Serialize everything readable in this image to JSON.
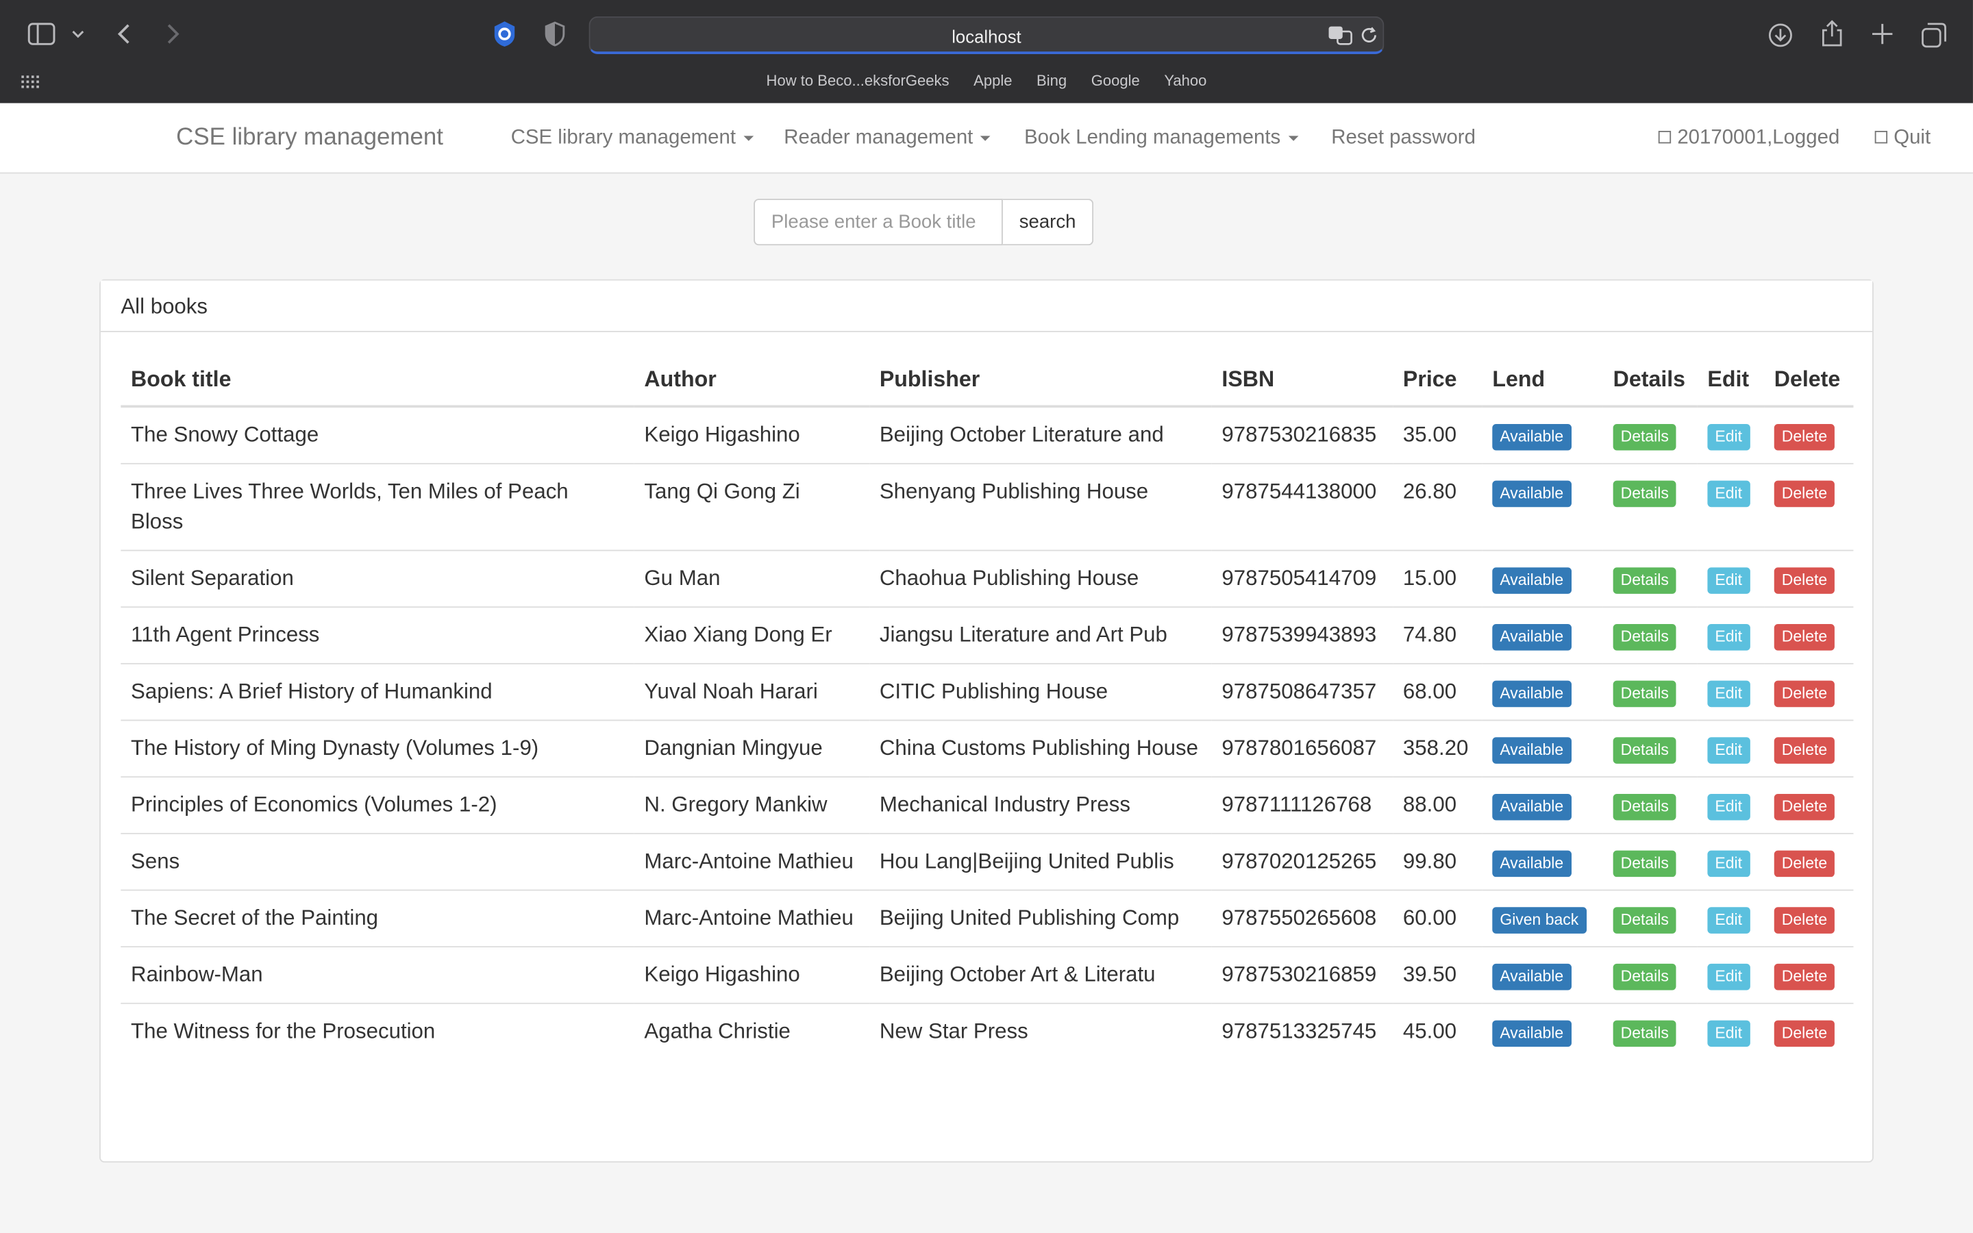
{
  "browser": {
    "url": "localhost",
    "favorites": [
      "How to Beco...eksforGeeks",
      "Apple",
      "Bing",
      "Google",
      "Yahoo"
    ]
  },
  "navbar": {
    "brand": "CSE library management",
    "menus": [
      "CSE library management",
      "Reader management",
      "Book Lending managements"
    ],
    "reset": "Reset password",
    "user": "20170001,Logged",
    "quit": "Quit"
  },
  "search": {
    "placeholder": "Please enter a Book title",
    "button": "search"
  },
  "panel": {
    "title": "All books"
  },
  "table": {
    "headers": [
      "Book title",
      "Author",
      "Publisher",
      "ISBN",
      "Price",
      "Lend",
      "Details",
      "Edit",
      "Delete"
    ],
    "rows": [
      {
        "title": "The Snowy Cottage",
        "author": "Keigo Higashino",
        "publisher": "Beijing October Literature and",
        "isbn": "9787530216835",
        "price": "35.00",
        "lend": "Available",
        "details": "Details",
        "edit": "Edit",
        "delete": "Delete"
      },
      {
        "title": "Three Lives Three Worlds, Ten Miles of Peach Bloss",
        "author": "Tang Qi Gong Zi",
        "publisher": "Shenyang Publishing House",
        "isbn": "9787544138000",
        "price": "26.80",
        "lend": "Available",
        "details": "Details",
        "edit": "Edit",
        "delete": "Delete"
      },
      {
        "title": "Silent Separation",
        "author": "Gu Man",
        "publisher": "Chaohua Publishing House",
        "isbn": "9787505414709",
        "price": "15.00",
        "lend": "Available",
        "details": "Details",
        "edit": "Edit",
        "delete": "Delete"
      },
      {
        "title": "11th Agent Princess",
        "author": "Xiao Xiang Dong Er",
        "publisher": "Jiangsu Literature and Art Pub",
        "isbn": "9787539943893",
        "price": "74.80",
        "lend": "Available",
        "details": "Details",
        "edit": "Edit",
        "delete": "Delete"
      },
      {
        "title": "Sapiens: A Brief History of Humankind",
        "author": "Yuval Noah Harari",
        "publisher": "CITIC Publishing House",
        "isbn": "9787508647357",
        "price": "68.00",
        "lend": "Available",
        "details": "Details",
        "edit": "Edit",
        "delete": "Delete"
      },
      {
        "title": "The History of Ming Dynasty (Volumes 1-9)",
        "author": "Dangnian Mingyue",
        "publisher": "China Customs Publishing House",
        "isbn": "9787801656087",
        "price": "358.20",
        "lend": "Available",
        "details": "Details",
        "edit": "Edit",
        "delete": "Delete"
      },
      {
        "title": "Principles of Economics (Volumes 1-2)",
        "author": "N. Gregory Mankiw",
        "publisher": "Mechanical Industry Press",
        "isbn": "9787111126768",
        "price": "88.00",
        "lend": "Available",
        "details": "Details",
        "edit": "Edit",
        "delete": "Delete"
      },
      {
        "title": "Sens",
        "author": "Marc-Antoine Mathieu",
        "publisher": "Hou Lang|Beijing United Publis",
        "isbn": "9787020125265",
        "price": "99.80",
        "lend": "Available",
        "details": "Details",
        "edit": "Edit",
        "delete": "Delete"
      },
      {
        "title": "The Secret of the Painting",
        "author": "Marc-Antoine Mathieu",
        "publisher": "Beijing United Publishing Comp",
        "isbn": "9787550265608",
        "price": "60.00",
        "lend": "Given back",
        "details": "Details",
        "edit": "Edit",
        "delete": "Delete"
      },
      {
        "title": "Rainbow-Man",
        "author": "Keigo Higashino",
        "publisher": "Beijing October Art & Literatu",
        "isbn": "9787530216859",
        "price": "39.50",
        "lend": "Available",
        "details": "Details",
        "edit": "Edit",
        "delete": "Delete"
      },
      {
        "title": "The Witness for the Prosecution",
        "author": "Agatha Christie",
        "publisher": "New Star Press",
        "isbn": "9787513325745",
        "price": "45.00",
        "lend": "Available",
        "details": "Details",
        "edit": "Edit",
        "delete": "Delete"
      }
    ]
  }
}
